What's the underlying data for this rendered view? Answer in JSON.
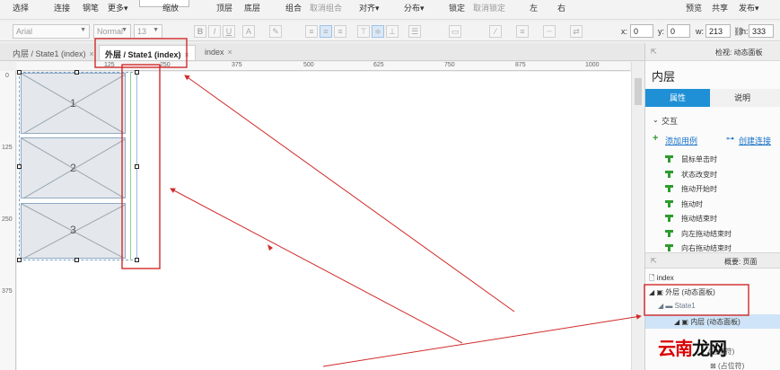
{
  "toolbar": {
    "select": "选择",
    "connect": "连接",
    "pen": "钢笔",
    "more": "更多▾",
    "zoom": "缩放",
    "top": "顶层",
    "bottom": "底层",
    "group": "组合",
    "ungroup": "取消组合",
    "align": "对齐▾",
    "distribute": "分布▾",
    "lock": "锁定",
    "unlock": "取消锁定",
    "left": "左",
    "right": "右",
    "preview": "预览",
    "share": "共享",
    "publish": "发布▾"
  },
  "format": {
    "font": "Arial",
    "style": "Normal",
    "size": "13",
    "bold": "B",
    "italic": "I",
    "underline": "U",
    "x_label": "x:",
    "x_value": "0",
    "y_label": "y:",
    "y_value": "0",
    "w_label": "w:",
    "w_value": "213",
    "h_label": "h:",
    "h_value": "333"
  },
  "tabs": [
    {
      "label": "内层 / State1 (index)",
      "close": "×"
    },
    {
      "label": "外层 / State1 (index)",
      "close": "×"
    },
    {
      "label": "index",
      "close": "×"
    }
  ],
  "ruler": {
    "h": [
      "125",
      "250",
      "375",
      "500",
      "625",
      "750",
      "875",
      "1000"
    ],
    "v": [
      "0",
      "125",
      "250",
      "375"
    ]
  },
  "canvas": {
    "panels": [
      "1",
      "2",
      "3"
    ]
  },
  "right_panel": {
    "header": "检视: 动态面板",
    "title": "内层",
    "tab_properties": "属性",
    "tab_notes": "说明",
    "interaction": "交互",
    "add_case": "添加用例",
    "create_link": "创建连接",
    "events": [
      "鼠标单击时",
      "状态改变时",
      "拖动开始时",
      "拖动时",
      "拖动结束时",
      "向左拖动结束时",
      "向右拖动结束时"
    ],
    "outline_header": "概要: 页面",
    "tree": {
      "index": "index",
      "outer": "外层 (动态面板)",
      "state": "State1",
      "inner": "内层 (动态面板)",
      "placeholder_a": "(占位符)",
      "placeholder_b": "(占位符)"
    }
  },
  "watermark": {
    "red": "云南",
    "black": "龙网"
  }
}
